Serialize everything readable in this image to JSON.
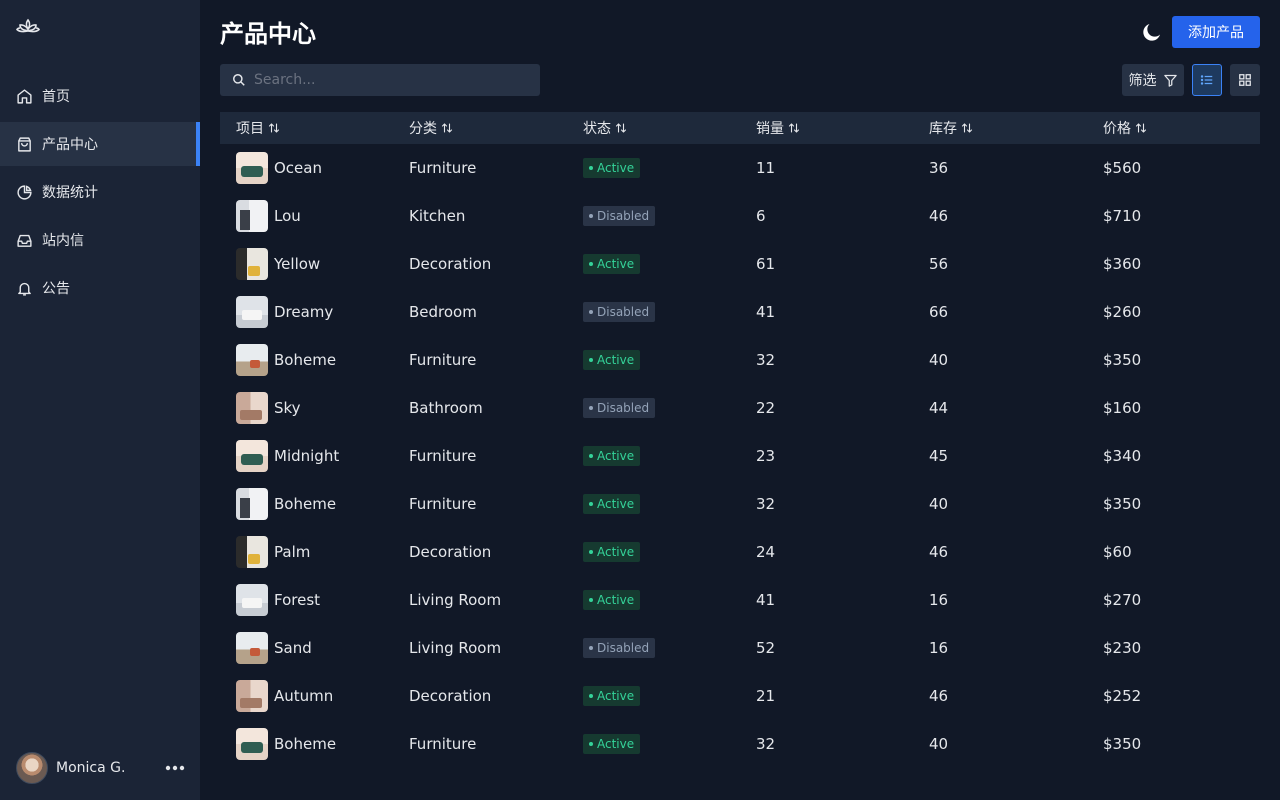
{
  "sidebar": {
    "items": [
      {
        "label": "首页",
        "icon": "home-icon"
      },
      {
        "label": "产品中心",
        "icon": "shopping-bag-icon",
        "active": true
      },
      {
        "label": "数据统计",
        "icon": "pie-chart-icon"
      },
      {
        "label": "站内信",
        "icon": "inbox-icon"
      },
      {
        "label": "公告",
        "icon": "bell-icon"
      }
    ],
    "user": {
      "name": "Monica G."
    }
  },
  "header": {
    "title": "产品中心",
    "add_label": "添加产品"
  },
  "search": {
    "placeholder": "Search..."
  },
  "toolbar": {
    "filter_label": "筛选",
    "view_mode": "list"
  },
  "colors": {
    "accent": "#2563eb",
    "active_text": "#34d399",
    "disabled_text": "#94a3b8"
  },
  "table": {
    "columns": [
      "项目",
      "分类",
      "状态",
      "销量",
      "库存",
      "价格"
    ],
    "rows": [
      {
        "name": "Ocean",
        "category": "Furniture",
        "status": "Active",
        "sales": "11",
        "stock": "36",
        "price": "$560",
        "thumb": "t1"
      },
      {
        "name": "Lou",
        "category": "Kitchen",
        "status": "Disabled",
        "sales": "6",
        "stock": "46",
        "price": "$710",
        "thumb": "t2"
      },
      {
        "name": "Yellow",
        "category": "Decoration",
        "status": "Active",
        "sales": "61",
        "stock": "56",
        "price": "$360",
        "thumb": "t3"
      },
      {
        "name": "Dreamy",
        "category": "Bedroom",
        "status": "Disabled",
        "sales": "41",
        "stock": "66",
        "price": "$260",
        "thumb": "t4"
      },
      {
        "name": "Boheme",
        "category": "Furniture",
        "status": "Active",
        "sales": "32",
        "stock": "40",
        "price": "$350",
        "thumb": "t5"
      },
      {
        "name": "Sky",
        "category": "Bathroom",
        "status": "Disabled",
        "sales": "22",
        "stock": "44",
        "price": "$160",
        "thumb": "t6"
      },
      {
        "name": "Midnight",
        "category": "Furniture",
        "status": "Active",
        "sales": "23",
        "stock": "45",
        "price": "$340",
        "thumb": "t1"
      },
      {
        "name": "Boheme",
        "category": "Furniture",
        "status": "Active",
        "sales": "32",
        "stock": "40",
        "price": "$350",
        "thumb": "t2"
      },
      {
        "name": "Palm",
        "category": "Decoration",
        "status": "Active",
        "sales": "24",
        "stock": "46",
        "price": "$60",
        "thumb": "t3"
      },
      {
        "name": "Forest",
        "category": "Living Room",
        "status": "Active",
        "sales": "41",
        "stock": "16",
        "price": "$270",
        "thumb": "t4"
      },
      {
        "name": "Sand",
        "category": "Living Room",
        "status": "Disabled",
        "sales": "52",
        "stock": "16",
        "price": "$230",
        "thumb": "t5"
      },
      {
        "name": "Autumn",
        "category": "Decoration",
        "status": "Active",
        "sales": "21",
        "stock": "46",
        "price": "$252",
        "thumb": "t6"
      },
      {
        "name": "Boheme",
        "category": "Furniture",
        "status": "Active",
        "sales": "32",
        "stock": "40",
        "price": "$350",
        "thumb": "t1"
      }
    ]
  }
}
